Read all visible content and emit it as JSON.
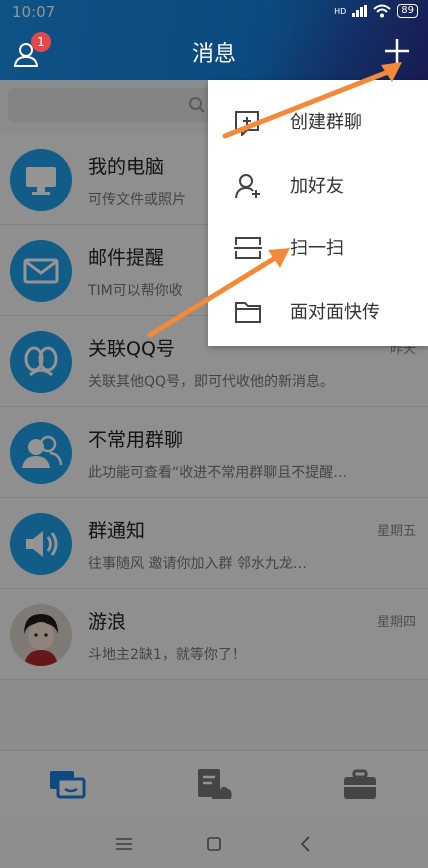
{
  "status_bar": {
    "time": "10:07",
    "battery": "89",
    "signal_label": "HD"
  },
  "header": {
    "title": "消息",
    "badge_count": "1"
  },
  "chats": [
    {
      "name": "我的电脑",
      "preview": "可传文件或照片",
      "time": "",
      "avatar": "computer-icon"
    },
    {
      "name": "邮件提醒",
      "preview": "TIM可以帮你收",
      "time": "",
      "avatar": "mail-icon"
    },
    {
      "name": "关联QQ号",
      "preview": "关联其他QQ号，即可代收他的新消息。",
      "time": "昨天",
      "avatar": "linked-accounts-icon"
    },
    {
      "name": "不常用群聊",
      "preview": "此功能可查看“收进不常用群聊且不提醒…",
      "time": "",
      "avatar": "group-icon"
    },
    {
      "name": "群通知",
      "preview": "往事随风 邀请你加入群 邻水九龙…",
      "time": "星期五",
      "avatar": "speaker-icon"
    },
    {
      "name": "游浪",
      "preview": "斗地主2缺1，就等你了！",
      "time": "星期四",
      "avatar": "user-photo"
    }
  ],
  "popup_menu": [
    {
      "label": "创建群聊",
      "icon": "create-group-icon"
    },
    {
      "label": "加好友",
      "icon": "add-friend-icon"
    },
    {
      "label": "扫一扫",
      "icon": "scan-icon"
    },
    {
      "label": "面对面快传",
      "icon": "folder-icon"
    }
  ],
  "colors": {
    "accent": "#1a8be4",
    "arrow": "#f28a3a",
    "badge": "#e24a4a"
  }
}
